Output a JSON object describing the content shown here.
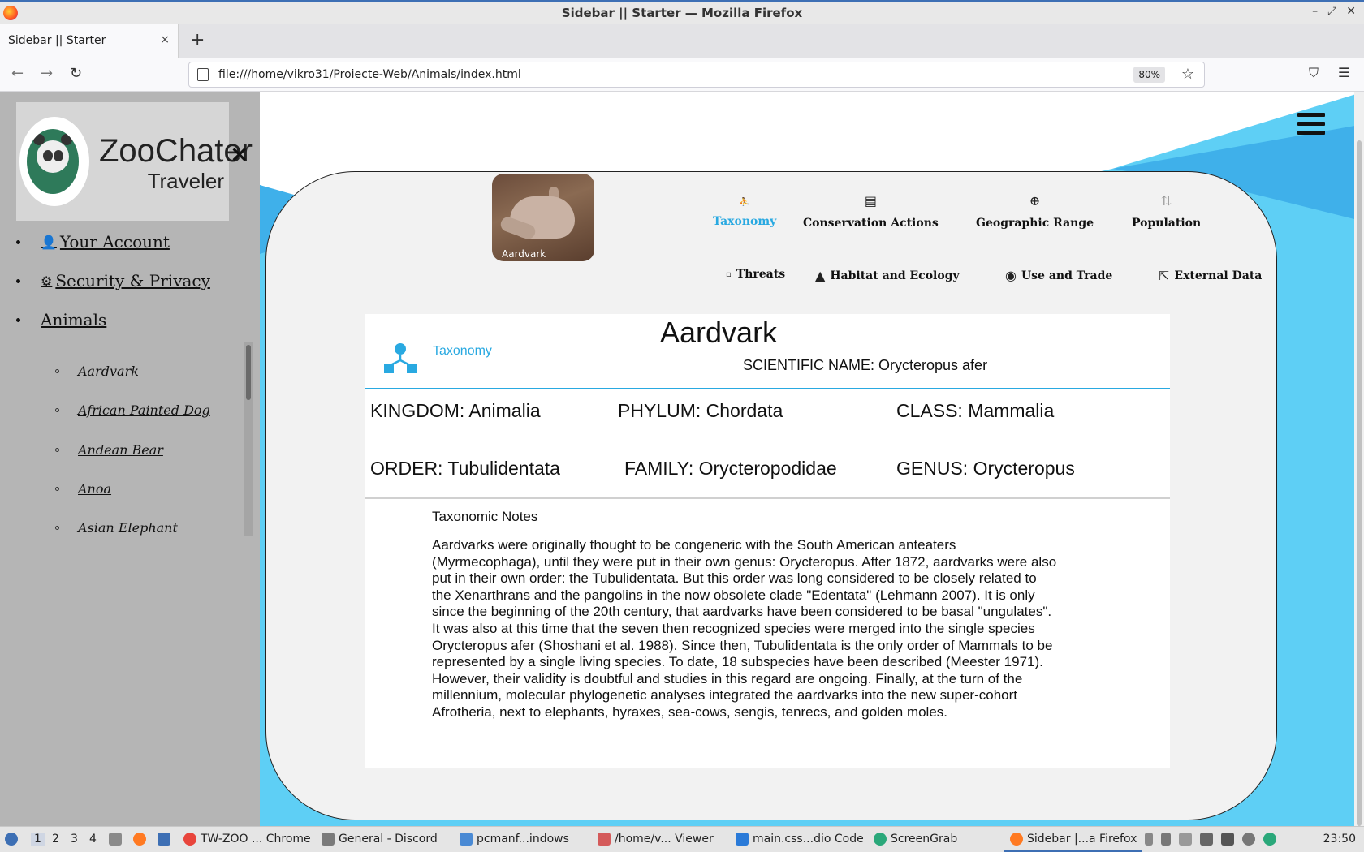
{
  "window": {
    "title": "Sidebar || Starter — Mozilla Firefox",
    "controls": [
      "–",
      "⤢",
      "✕"
    ]
  },
  "browser": {
    "tab_title": "Sidebar || Starter",
    "tab_close": "×",
    "new_tab": "+",
    "url": "file:///home/vikro31/Proiecte-Web/Animals/index.html",
    "zoom": "80%",
    "back": "←",
    "forward": "→",
    "reload": "↻",
    "bookmark": "☆",
    "pocket": "⛉",
    "menu": "☰"
  },
  "sidebar": {
    "brand_title": "ZooChater",
    "brand_subtitle": "Traveler",
    "close": "×",
    "menu": [
      {
        "label": "Your Account",
        "icon": "👤"
      },
      {
        "label": "Security & Privacy",
        "icon": "⚙"
      },
      {
        "label": "Animals",
        "icon": ""
      }
    ],
    "animals": [
      "Aardvark",
      "African Painted Dog",
      "Andean Bear",
      "Anoa",
      "Asian Elephant"
    ]
  },
  "card": {
    "photo_caption": "Aardvark",
    "tabs": [
      {
        "label": "Taxonomy",
        "icon": "person-icon",
        "glyph": "⛹"
      },
      {
        "label": "Conservation Actions",
        "icon": "list-icon",
        "glyph": "▤"
      },
      {
        "label": "Geographic Range",
        "icon": "globe-icon",
        "glyph": "⊕"
      },
      {
        "label": "Population",
        "icon": "sort-icon",
        "glyph": "⇅"
      },
      {
        "label": "Threats",
        "icon": "square-icon",
        "glyph": "▫"
      },
      {
        "label": "Habitat and Ecology",
        "icon": "mountain-icon",
        "glyph": "▲"
      },
      {
        "label": "Use and Trade",
        "icon": "eye-icon",
        "glyph": "◉"
      },
      {
        "label": "External Data",
        "icon": "external-link-icon",
        "glyph": "⇱"
      }
    ],
    "active_color": "#29a9e1"
  },
  "taxonomy": {
    "section_label": "Taxonomy",
    "name": "Aardvark",
    "scientific": "SCIENTIFIC NAME: Orycteropus afer",
    "kingdom": "KINGDOM: Animalia",
    "phylum": "PHYLUM: Chordata",
    "class": "CLASS: Mammalia",
    "order": "ORDER: Tubulidentata",
    "family": "FAMILY: Orycteropodidae",
    "genus": "GENUS: Orycteropus",
    "notes_title": "Taxonomic Notes",
    "notes": "Aardvarks were originally thought to be congeneric with the South American anteaters (Myrmecophaga), until they were put in their own genus: Orycteropus. After 1872, aardvarks were also put in their own order: the Tubulidentata. But this order was long considered to be closely related to the Xenarthrans and the pangolins in the now obsolete clade \"Edentata\" (Lehmann 2007). It is only since the beginning of the 20th century, that aardvarks have been considered to be basal \"ungulates\". It was also at this time that the seven then recognized species were merged into the single species Orycteropus afer (Shoshani et al. 1988). Since then, Tubulidentata is the only order of Mammals to be represented by a single living species. To date, 18 subspecies have been described (Meester 1971). However, their validity is doubtful and studies in this regard are ongoing. Finally, at the turn of the millennium, molecular phylogenetic analyses integrated the aardvarks into the new super-cohort Afrotheria, next to elephants, hyraxes, sea-cows, sengis, tenrecs, and golden moles."
  },
  "taskbar": {
    "workspaces": [
      "1",
      "2",
      "3",
      "4"
    ],
    "apps": [
      "TW-ZOO ... Chrome",
      "General - Discord",
      "pcmanf...indows",
      "/home/v... Viewer",
      "main.css...dio Code",
      "ScreenGrab",
      "Sidebar |...a Firefox"
    ],
    "clock": "23:50"
  },
  "colors": {
    "accent": "#29a9e1",
    "sidebar_bg": "#b5b5b5",
    "card_bg": "#f2f2f2"
  }
}
